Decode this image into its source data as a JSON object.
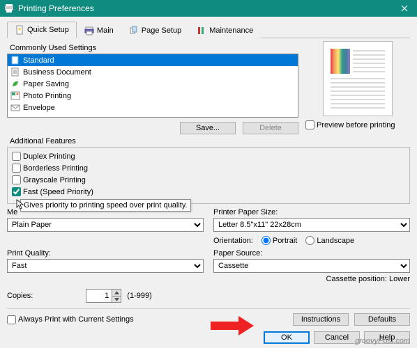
{
  "title": "Printing Preferences",
  "tabs": [
    {
      "label": "Quick Setup"
    },
    {
      "label": "Main"
    },
    {
      "label": "Page Setup"
    },
    {
      "label": "Maintenance"
    }
  ],
  "sections": {
    "commonly_used": {
      "label": "Commonly Used Settings",
      "items": [
        {
          "label": "Standard"
        },
        {
          "label": "Business Document"
        },
        {
          "label": "Paper Saving"
        },
        {
          "label": "Photo Printing"
        },
        {
          "label": "Envelope"
        }
      ],
      "save_btn": "Save...",
      "delete_btn": "Delete"
    },
    "preview_check": "Preview before printing",
    "additional": {
      "label": "Additional Features",
      "duplex": "Duplex Printing",
      "borderless": "Borderless Printing",
      "grayscale": "Grayscale Printing",
      "fast": "Fast (Speed Priority)",
      "tooltip": "Gives priority to printing speed over print quality."
    },
    "media": {
      "label_trunc": "Me",
      "value": "Plain Paper"
    },
    "paper_size": {
      "label": "Printer Paper Size:",
      "value": "Letter 8.5\"x11\" 22x28cm"
    },
    "orientation": {
      "label": "Orientation:",
      "portrait": "Portrait",
      "landscape": "Landscape"
    },
    "quality": {
      "label": "Print Quality:",
      "value": "Fast"
    },
    "source": {
      "label": "Paper Source:",
      "value": "Cassette"
    },
    "cassette_pos": "Cassette position: Lower",
    "copies": {
      "label": "Copies:",
      "value": "1",
      "range": "(1-999)"
    },
    "always_print": "Always Print with Current Settings",
    "instructions_btn": "Instructions",
    "defaults_btn": "Defaults"
  },
  "dialog": {
    "ok": "OK",
    "cancel": "Cancel",
    "help": "Help"
  },
  "watermark": "groovyPost.com"
}
